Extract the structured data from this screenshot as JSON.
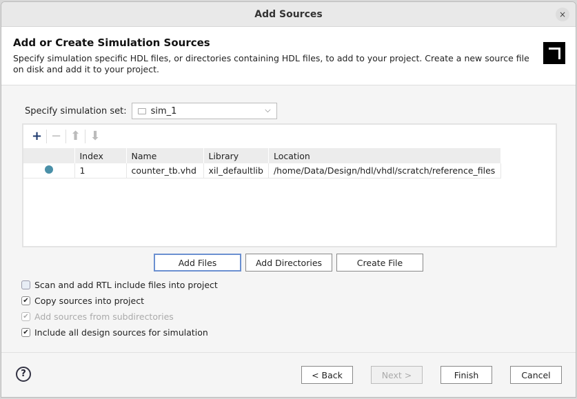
{
  "window": {
    "title": "Add Sources",
    "close": "×"
  },
  "header": {
    "title": "Add or Create Simulation Sources",
    "description": "Specify simulation specific HDL files, or directories containing HDL files, to add to your project. Create a new source file on disk and add it to your project."
  },
  "simset": {
    "label": "Specify simulation set:",
    "value": "sim_1"
  },
  "toolbar": {
    "add": "+",
    "remove": "−",
    "up": "⬆",
    "down": "⬇"
  },
  "table": {
    "columns": [
      "",
      "Index",
      "Name",
      "Library",
      "Location"
    ],
    "rows": [
      {
        "index": "1",
        "name": "counter_tb.vhd",
        "library": "xil_defaultlib",
        "location": "/home/Data/Design/hdl/vhdl/scratch/reference_files"
      }
    ]
  },
  "buttons": {
    "add_files": "Add Files",
    "add_dirs": "Add Directories",
    "create_file": "Create File",
    "back": "< Back",
    "next": "Next >",
    "finish": "Finish",
    "cancel": "Cancel",
    "help": "?"
  },
  "options": [
    {
      "label": "Scan and add RTL include files into project",
      "checked": false
    },
    {
      "label": "Copy sources into project",
      "checked": true
    },
    {
      "label": "Add sources from subdirectories",
      "checked": true,
      "disabled": true
    },
    {
      "label": "Include all design sources for simulation",
      "checked": true
    }
  ]
}
